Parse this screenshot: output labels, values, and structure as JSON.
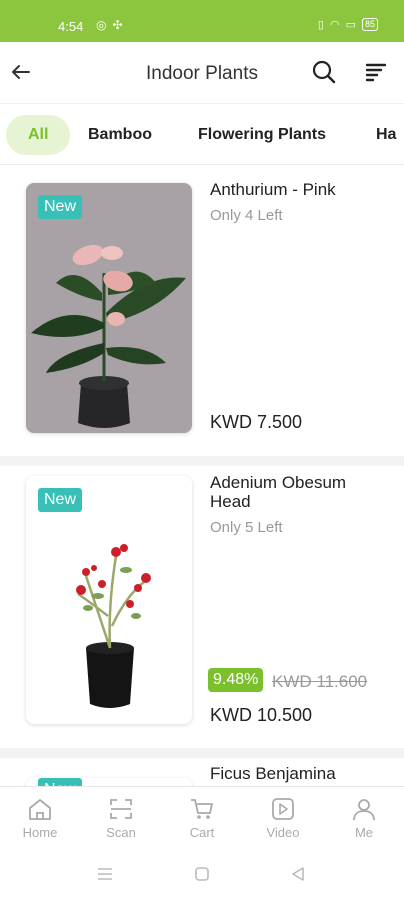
{
  "status_bar": {
    "time": "4:54",
    "battery": "85"
  },
  "header": {
    "title": "Indoor Plants"
  },
  "tabs": [
    "All",
    "Bamboo",
    "Flowering Plants",
    "Ha"
  ],
  "products": [
    {
      "badge": "New",
      "name": "Anthurium - Pink",
      "stock": "Only 4 Left",
      "price": "KWD 7.500"
    },
    {
      "badge": "New",
      "name": "Adenium Obesum Head",
      "stock": "Only 5 Left",
      "discount": "9.48%",
      "old_price": "KWD 11.600",
      "price": "KWD 10.500"
    },
    {
      "badge": "New",
      "name": "Ficus Benjamina"
    }
  ],
  "bottom_nav": [
    "Home",
    "Scan",
    "Cart",
    "Video",
    "Me"
  ],
  "colors": {
    "brand_green": "#8cc63f",
    "badge_teal": "#39c0b6",
    "discount_green": "#7cbf2d"
  }
}
